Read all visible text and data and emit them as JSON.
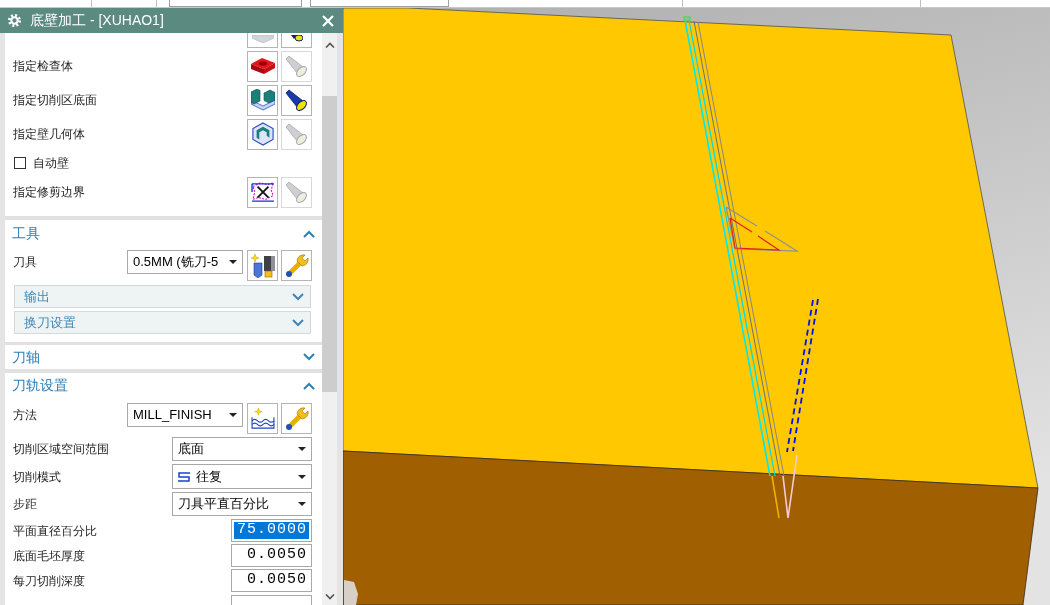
{
  "dialog": {
    "title": "底壁加工 - [XUHAO1]"
  },
  "geometry": {
    "rows": [
      {
        "kind": "cut_off",
        "display_disabled": false
      },
      {
        "kind": "selector",
        "label": "指定检查体",
        "display_disabled": true
      },
      {
        "kind": "selector",
        "label": "指定切削区底面",
        "display_disabled": false
      },
      {
        "kind": "selector",
        "label": "指定壁几何体",
        "display_disabled": true
      },
      {
        "kind": "checkbox",
        "label": "自动壁",
        "checked": false
      },
      {
        "kind": "selector",
        "label": "指定修剪边界",
        "display_disabled": true
      }
    ]
  },
  "sections": [
    {
      "title": "工具",
      "expanded": true,
      "rows": [
        {
          "kind": "tool_select",
          "label": "刀具",
          "value": "0.5MM (铣刀-5"
        }
      ],
      "subsections": [
        {
          "title": "输出",
          "expanded": false
        },
        {
          "title": "换刀设置",
          "expanded": false
        }
      ]
    },
    {
      "title": "刀轴",
      "expanded": false
    },
    {
      "title": "刀轨设置",
      "expanded": true,
      "rows": [
        {
          "kind": "method_select",
          "label": "方法",
          "value": "MILL_FINISH"
        },
        {
          "kind": "dropdown",
          "label": "切削区域空间范围",
          "value": "底面"
        },
        {
          "kind": "pattern_dropdown",
          "label": "切削模式",
          "value": "往复"
        },
        {
          "kind": "dropdown",
          "label": "步距",
          "value": "刀具平直百分比"
        },
        {
          "kind": "number",
          "label": "平面直径百分比",
          "value": "75.0000",
          "text_selected": true
        },
        {
          "kind": "number",
          "label": "底面毛坯厚度",
          "value": "0.0050",
          "text_selected": false
        },
        {
          "kind": "number",
          "label": "每刀切削深度",
          "value": "0.0050",
          "text_selected": false
        },
        {
          "kind": "cut_off_number"
        }
      ]
    }
  ]
}
